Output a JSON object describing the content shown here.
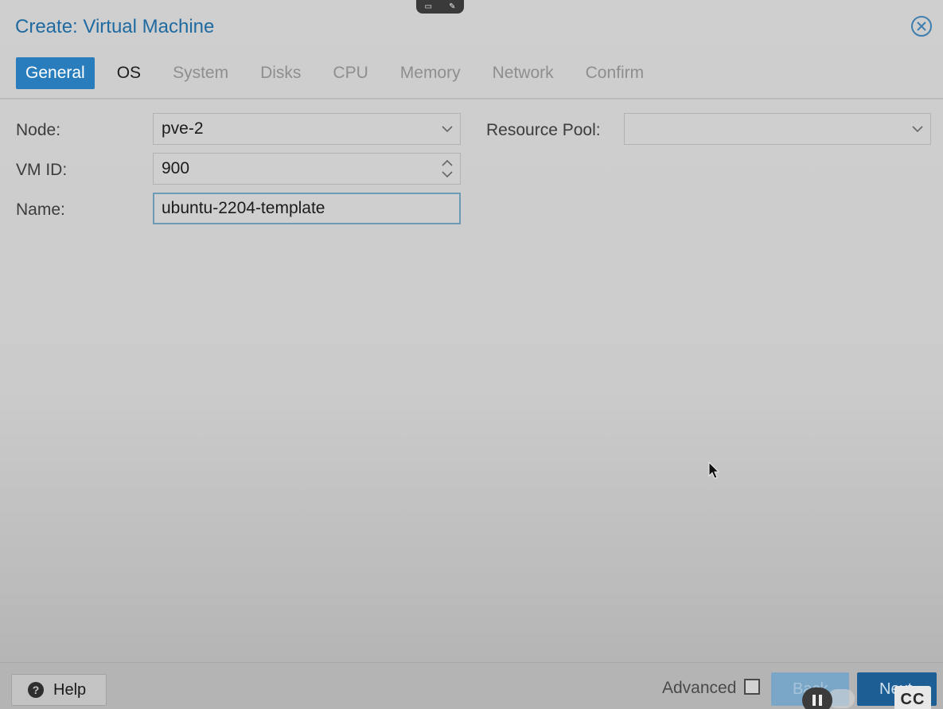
{
  "window": {
    "title": "Create: Virtual Machine"
  },
  "tabs": [
    {
      "label": "General",
      "state": "active"
    },
    {
      "label": "OS",
      "state": "enabled"
    },
    {
      "label": "System",
      "state": "disabled"
    },
    {
      "label": "Disks",
      "state": "disabled"
    },
    {
      "label": "CPU",
      "state": "disabled"
    },
    {
      "label": "Memory",
      "state": "disabled"
    },
    {
      "label": "Network",
      "state": "disabled"
    },
    {
      "label": "Confirm",
      "state": "disabled"
    }
  ],
  "form": {
    "node": {
      "label": "Node:",
      "value": "pve-2"
    },
    "vmid": {
      "label": "VM ID:",
      "value": "900"
    },
    "name": {
      "label": "Name:",
      "value": "ubuntu-2204-template"
    },
    "resource_pool": {
      "label": "Resource Pool:",
      "value": ""
    }
  },
  "footer": {
    "help_label": "Help",
    "advanced_label": "Advanced",
    "advanced_checked": false,
    "back_label": "Back",
    "next_label": "Next"
  },
  "player": {
    "cc_label": "CC"
  },
  "colors": {
    "accent": "#2a7dbd",
    "title": "#1f6aa1",
    "next_button": "#1d5f94"
  }
}
